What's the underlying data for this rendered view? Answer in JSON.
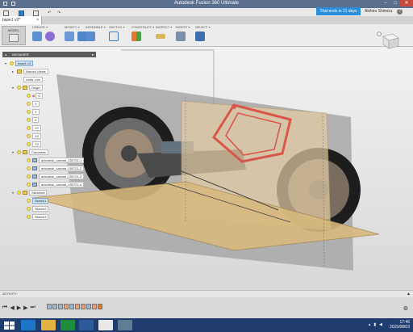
{
  "window": {
    "title": "Autodesk Fusion 360 Ultimate"
  },
  "quickbar": {
    "trial": "Trial ends in 21 days",
    "user": "Akihiro Shimizu",
    "help": "?"
  },
  "tab": {
    "name": "base1 v2*"
  },
  "toolbar": {
    "workspace": "MODEL",
    "groups": [
      {
        "label": "CREATE"
      },
      {
        "label": "MODIFY"
      },
      {
        "label": "ASSEMBLE"
      },
      {
        "label": "SKETCH"
      },
      {
        "label": "CONSTRUCT"
      },
      {
        "label": "INSPECT"
      },
      {
        "label": "INSERT"
      },
      {
        "label": "SELECT"
      }
    ]
  },
  "browser": {
    "title": "BROWSER",
    "items": [
      {
        "label": "base1 v2",
        "icon": "component",
        "selected": true
      },
      {
        "label": "Named Views",
        "icon": "folder"
      },
      {
        "label": "Units: mm",
        "icon": "none"
      },
      {
        "label": "Origin",
        "icon": "folder"
      },
      {
        "label": "O",
        "icon": "origin-point"
      },
      {
        "label": "X",
        "icon": "axis"
      },
      {
        "label": "Y",
        "icon": "axis"
      },
      {
        "label": "Z",
        "icon": "axis"
      },
      {
        "label": "XY",
        "icon": "plane"
      },
      {
        "label": "XZ",
        "icon": "plane"
      },
      {
        "label": "YZ",
        "icon": "plane"
      },
      {
        "label": "Canvases",
        "icon": "folder"
      },
      {
        "label": "autodesk_canvas_150721-1",
        "icon": "canvas"
      },
      {
        "label": "autodesk_canvas_150721-2",
        "icon": "canvas"
      },
      {
        "label": "autodesk_canvas_150721-3",
        "icon": "canvas"
      },
      {
        "label": "autodesk_canvas_150721-4",
        "icon": "canvas"
      },
      {
        "label": "Sketches",
        "icon": "folder"
      },
      {
        "label": "Sketch1",
        "icon": "sketch",
        "selected": true
      },
      {
        "label": "Sketch2",
        "icon": "sketch"
      },
      {
        "label": "Sketch3",
        "icon": "sketch"
      }
    ]
  },
  "activity": {
    "label": "ACTIVITY"
  },
  "taskbar": {
    "time": "17:46",
    "date": "2015/08/03"
  },
  "colors": {
    "titlebar": "#5a6f8e",
    "accent": "#2a8fd8",
    "taskbar": "#1f3c6e",
    "sketch": "#d9564a"
  }
}
